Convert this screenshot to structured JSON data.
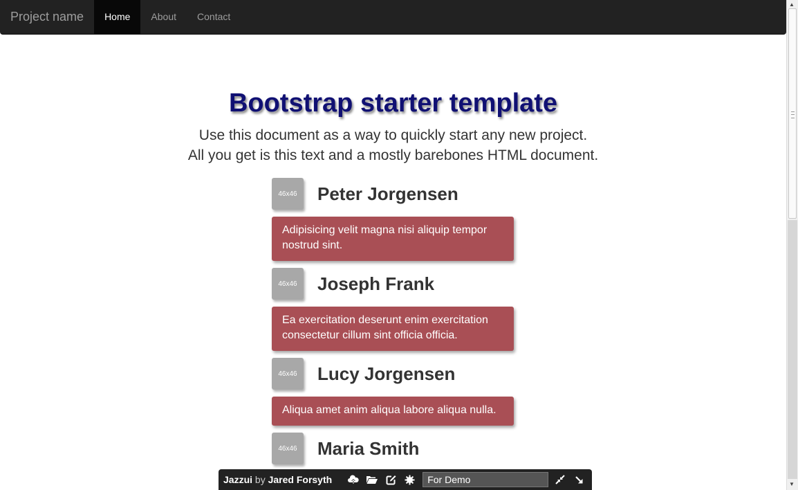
{
  "navbar": {
    "brand": "Project name",
    "items": [
      {
        "label": "Home",
        "active": true
      },
      {
        "label": "About",
        "active": false
      },
      {
        "label": "Contact",
        "active": false
      }
    ]
  },
  "hero": {
    "title": "Bootstrap starter template",
    "lead_line1": "Use this document as a way to quickly start any new project.",
    "lead_line2": "All you get is this text and a mostly barebones HTML document."
  },
  "people": [
    {
      "avatar": "46x46",
      "name": "Peter Jorgensen",
      "message": "Adipisicing velit magna nisi aliquip tempor nostrud sint."
    },
    {
      "avatar": "46x46",
      "name": "Joseph Frank",
      "message": "Ea exercitation deserunt enim exercitation consectetur cillum sint officia officia."
    },
    {
      "avatar": "46x46",
      "name": "Lucy Jorgensen",
      "message": "Aliqua amet anim aliqua labore aliqua nulla."
    },
    {
      "avatar": "46x46",
      "name": "Maria Smith"
    }
  ],
  "jazzui": {
    "app_name": "Jazzui",
    "by": "by",
    "author": "Jared Forsyth",
    "icons": [
      "cloud-upload-icon",
      "folder-open-icon",
      "edit-icon",
      "settings-gear-icon"
    ],
    "input_value": "For Demo",
    "right_icons": [
      "compress-icon",
      "arrow-down-right-icon"
    ]
  },
  "colors": {
    "navbar_bg": "#222222",
    "title": "#101073",
    "bubble": "#a94f55",
    "avatar": "#a8a8a8"
  }
}
